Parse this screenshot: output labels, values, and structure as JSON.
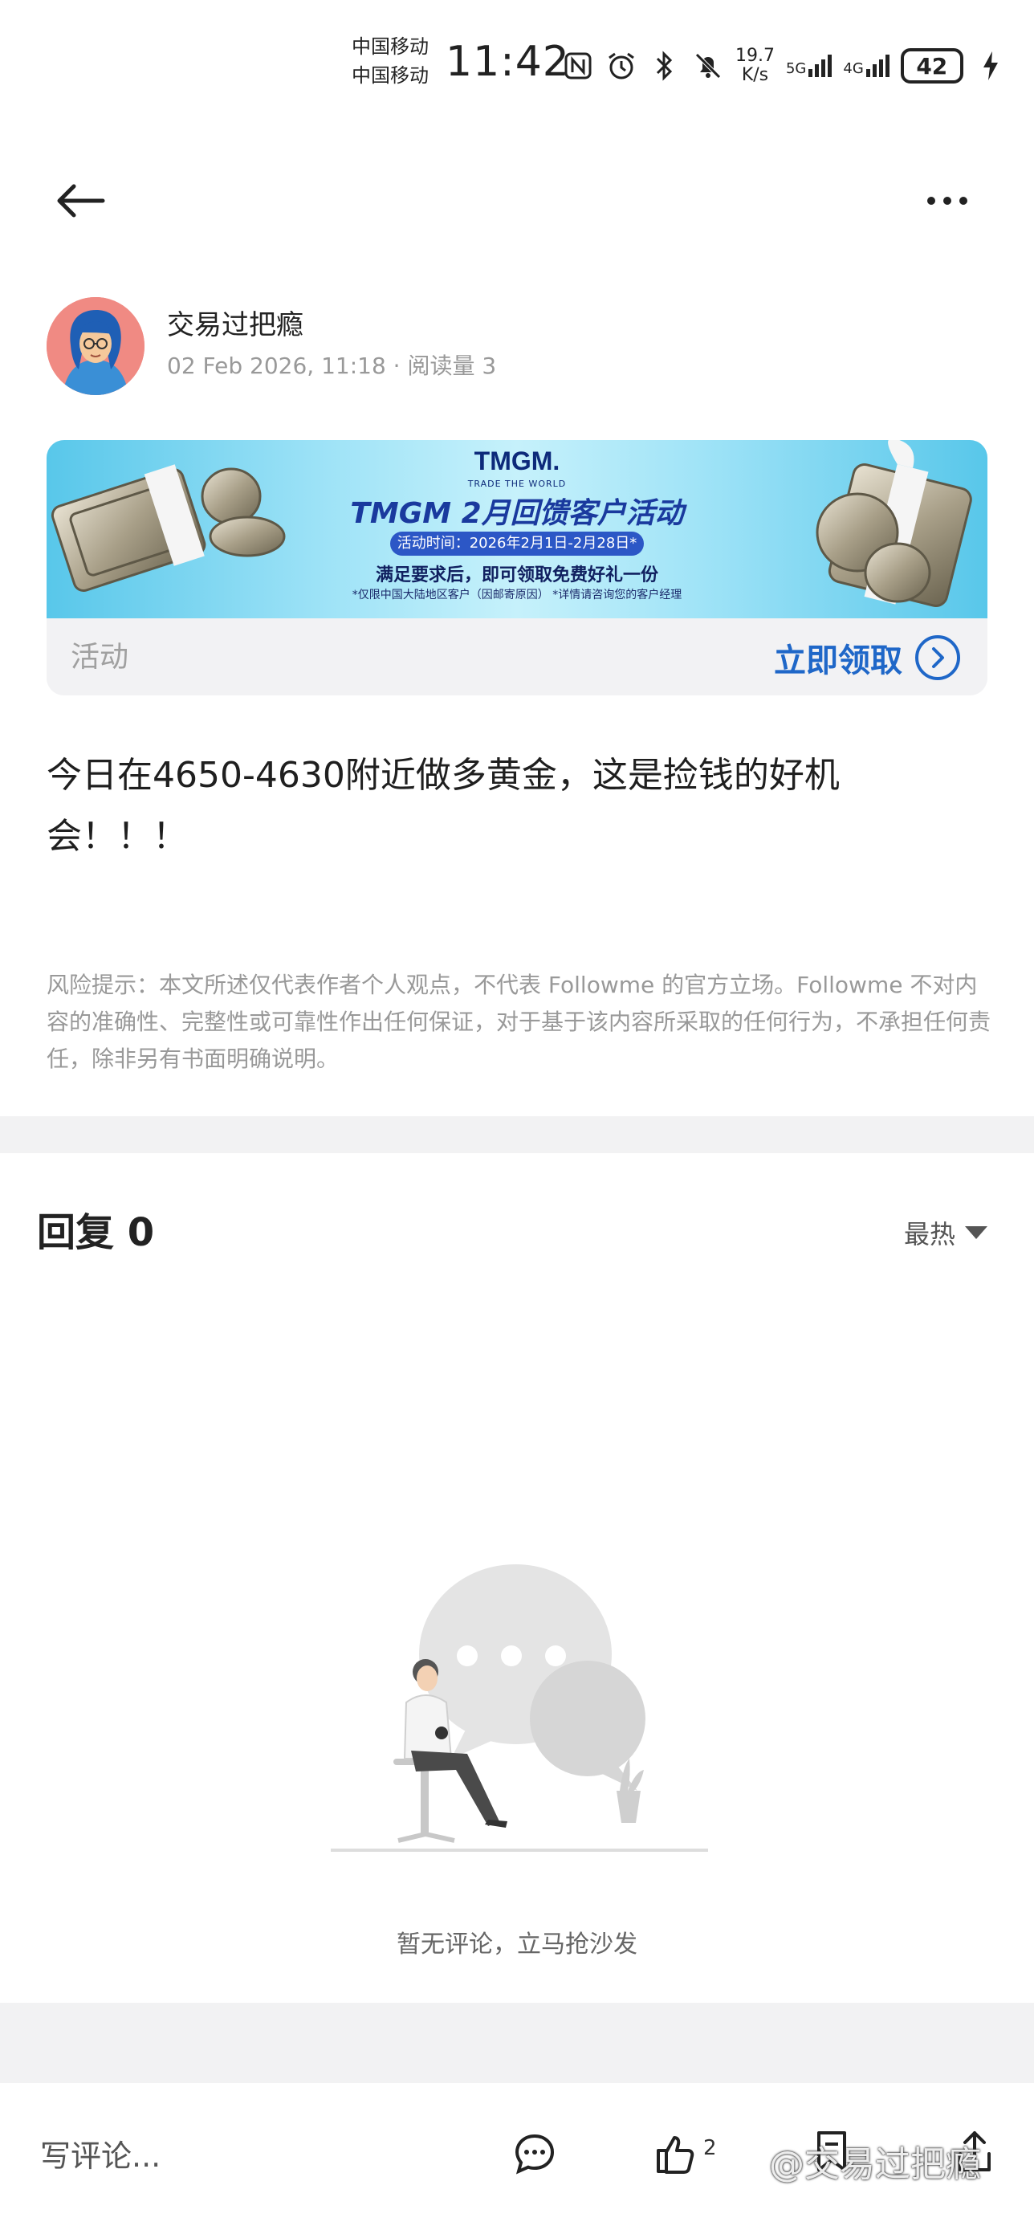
{
  "status_bar": {
    "carrier_1": "中国移动",
    "carrier_2": "中国移动",
    "time": "11:42",
    "net_speed_value": "19.7",
    "net_speed_unit": "K/s",
    "network_1": "5G",
    "network_2": "4G",
    "battery": "42"
  },
  "author": {
    "name": "交易过把瘾",
    "date": "02 Feb 2026, 11:18",
    "reads": "阅读量 3"
  },
  "banner": {
    "brand": "TMGM.",
    "slogan": "TRADE THE WORLD",
    "title": "TMGM 2月回馈客户活动",
    "date": "活动时间：2026年2月1日-2月28日*",
    "offer": "满足要求后，即可领取免费好礼一份",
    "note": "*仅限中国大陆地区客户（因邮寄原因） *详情请咨询您的客户经理",
    "tag": "活动",
    "cta": "立即领取"
  },
  "post": {
    "text": "今日在4650-4630附近做多黄金，这是捡钱的好机会！！！"
  },
  "risk_notice": "风险提示：本文所述仅代表作者个人观点，不代表 Followme 的官方立场。Followme 不对内容的准确性、完整性或可靠性作出任何保证，对于基于该内容所采取的任何行为，不承担任何责任，除非另有书面明确说明。",
  "replies": {
    "title": "回复 0",
    "sort": "最热",
    "empty_text": "暂无评论，立马抢沙发"
  },
  "bottom_bar": {
    "comment_placeholder": "写评论...",
    "like_count": "2",
    "watermark": "@交易过把瘾"
  },
  "colors": {
    "accent": "#1f67c8",
    "muted": "#999999",
    "divider": "#f2f2f3"
  }
}
